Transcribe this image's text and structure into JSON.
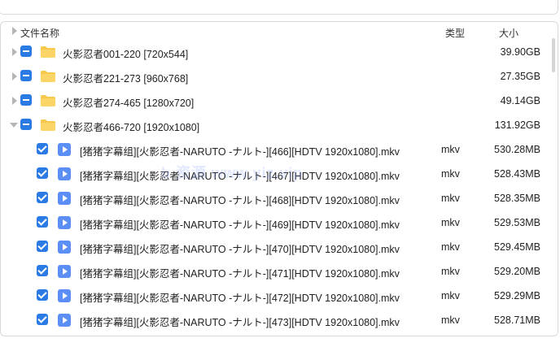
{
  "header": {
    "name": "文件名称",
    "type": "类型",
    "size": "大小"
  },
  "folders": [
    {
      "name": "火影忍者001-220 [720x544]",
      "size": "39.90GB",
      "expanded": false
    },
    {
      "name": "火影忍者221-273 [960x768]",
      "size": "27.35GB",
      "expanded": false
    },
    {
      "name": "火影忍者274-465 [1280x720]",
      "size": "49.14GB",
      "expanded": false
    },
    {
      "name": "火影忍者466-720 [1920x1080]",
      "size": "131.92GB",
      "expanded": true
    }
  ],
  "files": [
    {
      "name": "[猪猪字幕组][火影忍者-NARUTO -ナルト-][466][HDTV 1920x1080].mkv",
      "type": "mkv",
      "size": "530.28MB"
    },
    {
      "name": "[猪猪字幕组][火影忍者-NARUTO -ナルト-][467][HDTV 1920x1080].mkv",
      "type": "mkv",
      "size": "528.43MB"
    },
    {
      "name": "[猪猪字幕组][火影忍者-NARUTO -ナルト-][468][HDTV 1920x1080].mkv",
      "type": "mkv",
      "size": "528.35MB"
    },
    {
      "name": "[猪猪字幕组][火影忍者-NARUTO -ナルト-][469][HDTV 1920x1080].mkv",
      "type": "mkv",
      "size": "529.53MB"
    },
    {
      "name": "[猪猪字幕组][火影忍者-NARUTO -ナルト-][470][HDTV 1920x1080].mkv",
      "type": "mkv",
      "size": "529.45MB"
    },
    {
      "name": "[猪猪字幕组][火影忍者-NARUTO -ナルト-][471][HDTV 1920x1080].mkv",
      "type": "mkv",
      "size": "529.20MB"
    },
    {
      "name": "[猪猪字幕组][火影忍者-NARUTO -ナルト-][472][HDTV 1920x1080].mkv",
      "type": "mkv",
      "size": "529.29MB"
    },
    {
      "name": "[猪猪字幕组][火影忍者-NARUTO -ナルト-][473][HDTV 1920x1080].mkv",
      "type": "mkv",
      "size": "528.71MB"
    }
  ],
  "watermark": "b 资源 www.yiz.vip",
  "colors": {
    "accent": "#2c7be5",
    "folder": "#f8c84a",
    "video": "#5b8ff5"
  }
}
